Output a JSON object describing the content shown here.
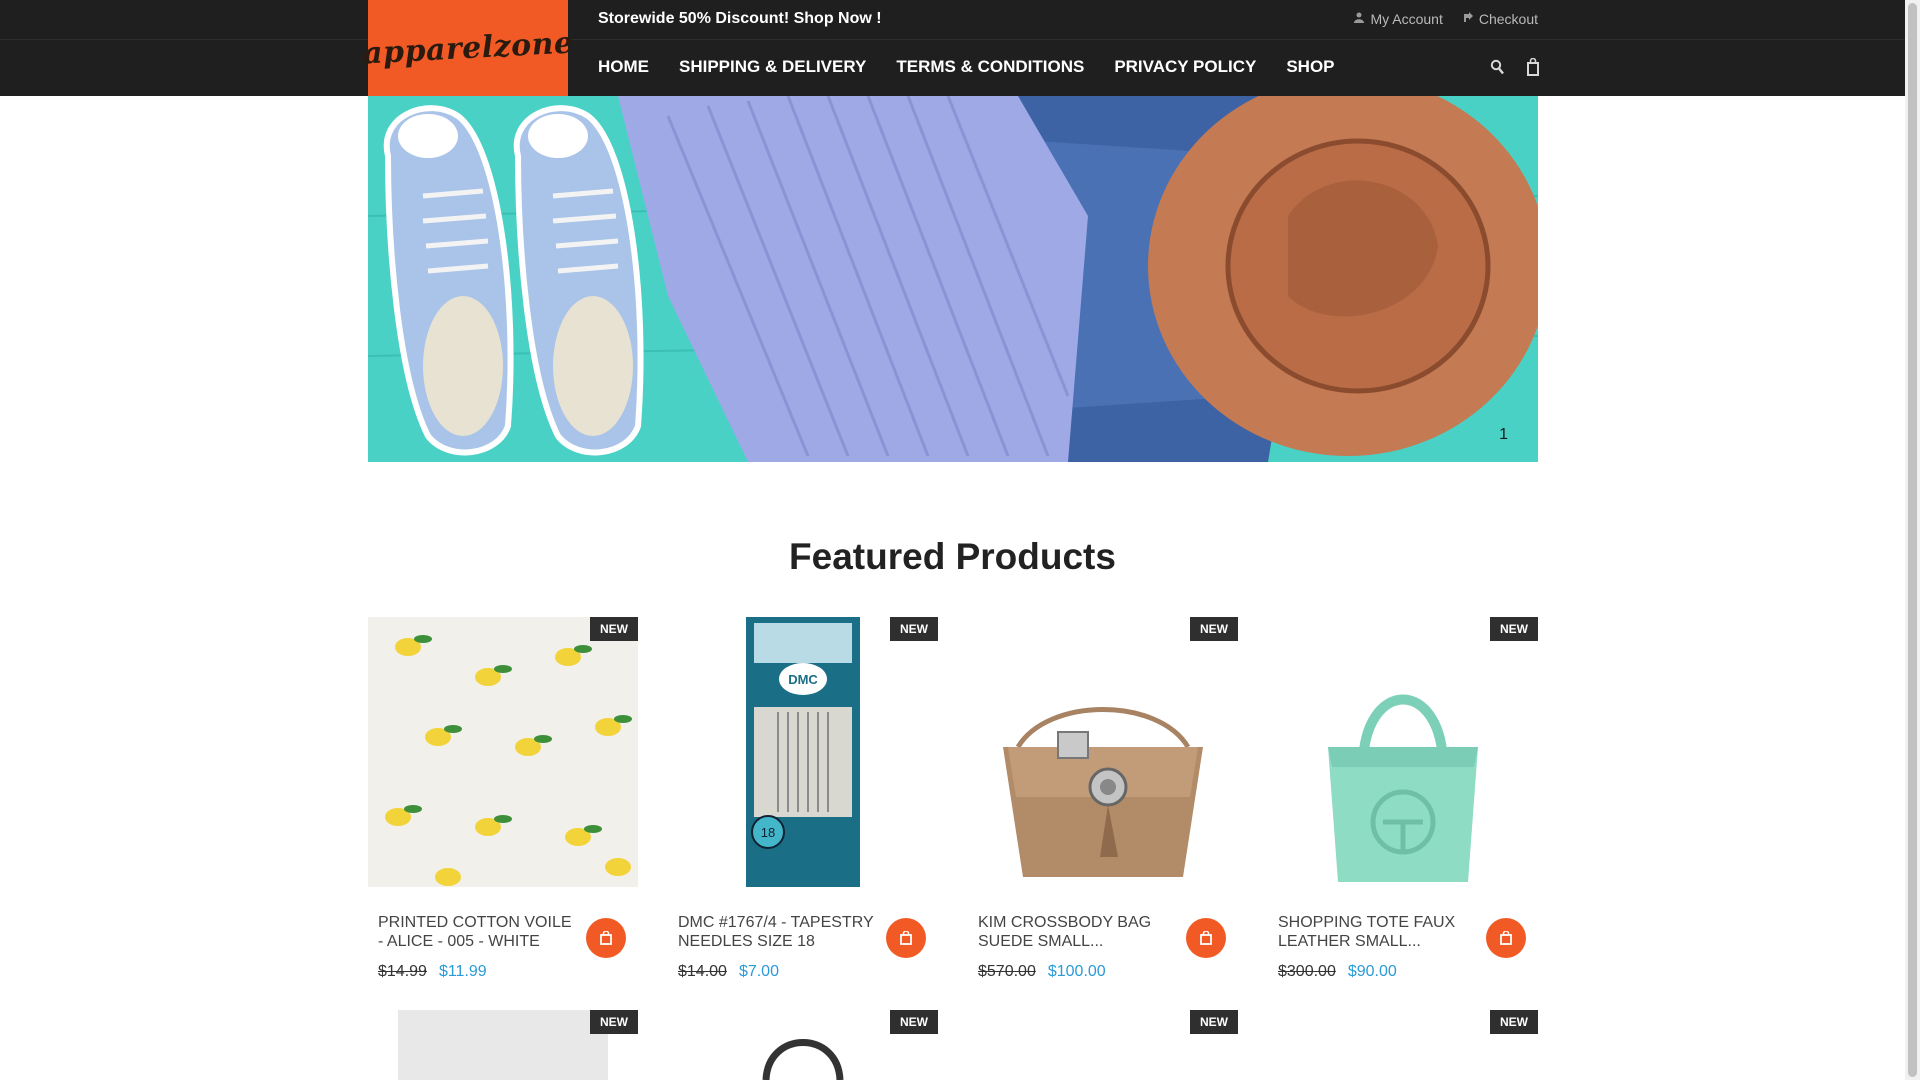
{
  "header": {
    "logo_text": "apparelzone",
    "promo": "Storewide 50% Discount! Shop Now !",
    "links": [
      {
        "label": "My Account",
        "icon": "user-icon"
      },
      {
        "label": "Checkout",
        "icon": "share-icon"
      }
    ]
  },
  "nav": {
    "items": [
      "HOME",
      "SHIPPING & DELIVERY",
      "TERMS & CONDITIONS",
      "PRIVACY POLICY",
      "SHOP"
    ],
    "icons": [
      "search-icon",
      "cart-icon"
    ]
  },
  "hero": {
    "slide_number": "1"
  },
  "featured": {
    "title": "Featured Products",
    "badge": "NEW",
    "products": [
      {
        "name": "PRINTED COTTON VOILE - ALICE - 005 - WHITE",
        "old_price": "$14.99",
        "new_price": "$11.99"
      },
      {
        "name": "DMC #1767/4 - TAPESTRY NEEDLES SIZE 18",
        "old_price": "$14.00",
        "new_price": "$7.00"
      },
      {
        "name": "KIM CROSSBODY BAG SUEDE SMALL...",
        "old_price": "$570.00",
        "new_price": "$100.00"
      },
      {
        "name": "SHOPPING TOTE FAUX LEATHER SMALL...",
        "old_price": "$300.00",
        "new_price": "$90.00"
      }
    ]
  },
  "colors": {
    "accent": "#f15a24",
    "dark": "#1f1f1f",
    "price_blue": "#2a9bd6"
  }
}
